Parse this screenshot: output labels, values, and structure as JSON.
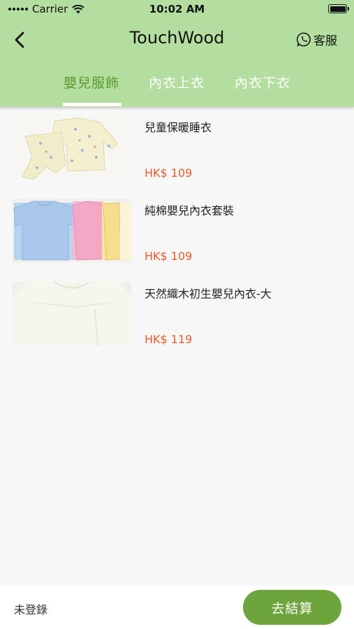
{
  "status_bar": {
    "carrier": "Carrier",
    "time": "10:02 AM"
  },
  "nav": {
    "title": "TouchWood",
    "service_label": "客服"
  },
  "tabs": [
    {
      "label": "嬰兒服飾",
      "active": true
    },
    {
      "label": "內衣上衣",
      "active": false
    },
    {
      "label": "內衣下衣",
      "active": false
    }
  ],
  "products": [
    {
      "name": "兒童保暖睡衣",
      "price": "HK$ 109"
    },
    {
      "name": "純棉嬰兒內衣套裝",
      "price": "HK$ 109"
    },
    {
      "name": "天然織木初生嬰兒內衣-大",
      "price": "HK$ 119"
    }
  ],
  "bottom": {
    "login_status": "未登錄",
    "checkout_label": "去結算"
  },
  "colors": {
    "header": "#b3dea0",
    "active_tab": "#5a9a2e",
    "price": "#e85a2c",
    "checkout": "#6da53c"
  }
}
